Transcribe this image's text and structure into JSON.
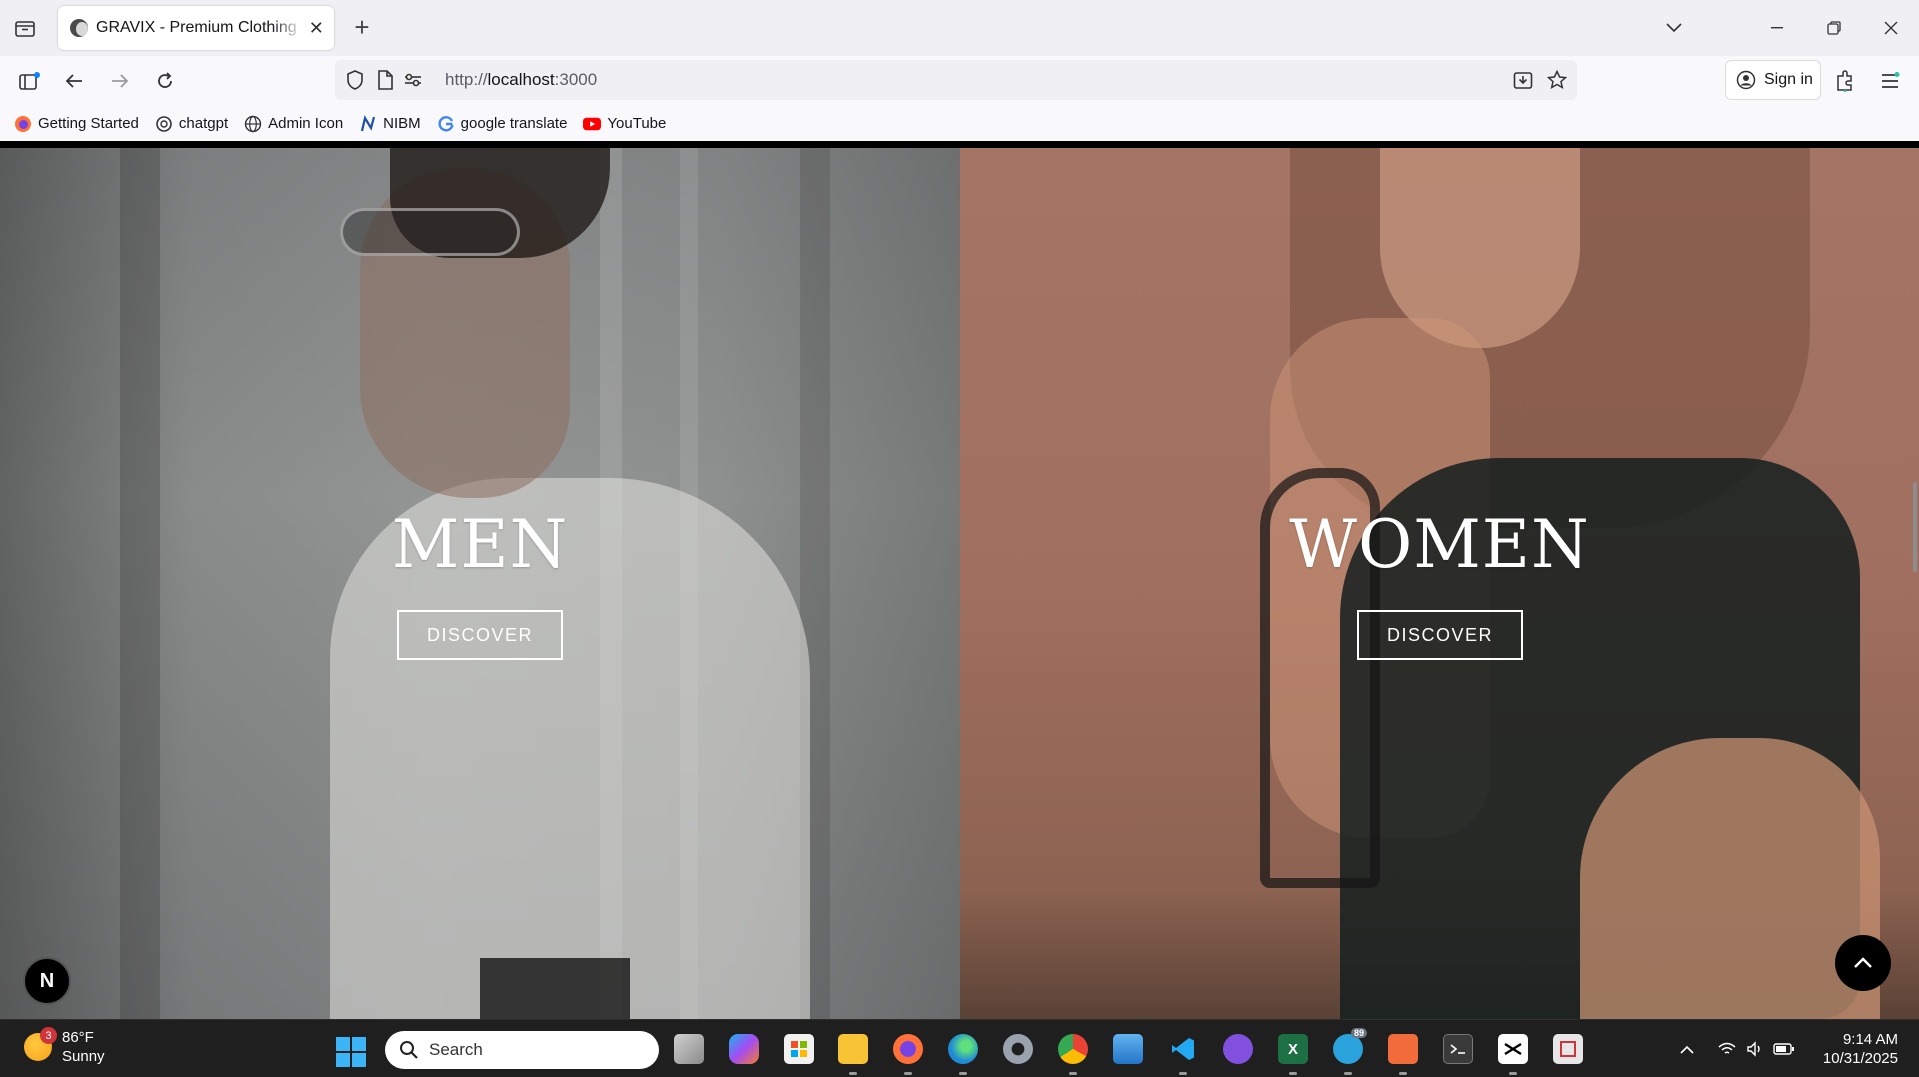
{
  "browser": {
    "tab": {
      "title": "GRAVIX - Premium Clothing Store"
    },
    "url": {
      "scheme": "http://",
      "host": "localhost",
      "port": ":3000"
    },
    "sign_in_label": "Sign in",
    "bookmarks": [
      {
        "label": "Getting Started",
        "icon": "firefox-icon"
      },
      {
        "label": "chatgpt",
        "icon": "openai-icon"
      },
      {
        "label": "Admin Icon",
        "icon": "globe-icon"
      },
      {
        "label": "NIBM",
        "icon": "nibm-icon"
      },
      {
        "label": "google translate",
        "icon": "google-icon"
      },
      {
        "label": "YouTube",
        "icon": "youtube-icon"
      }
    ]
  },
  "page": {
    "men": {
      "title": "MEN",
      "button": "DISCOVER"
    },
    "women": {
      "title": "WOMEN",
      "button": "DISCOVER"
    },
    "badge_letter": "N"
  },
  "taskbar": {
    "weather": {
      "temp": "86°F",
      "condition": "Sunny",
      "alerts": "3"
    },
    "search_placeholder": "Search",
    "telegram_badge": "89",
    "clock": {
      "time": "9:14 AM",
      "date": "10/31/2025"
    }
  },
  "colors": {
    "accent_red": "#d13438",
    "taskbar_bg": "#1f1f1f",
    "women_panel": "#a47565"
  }
}
